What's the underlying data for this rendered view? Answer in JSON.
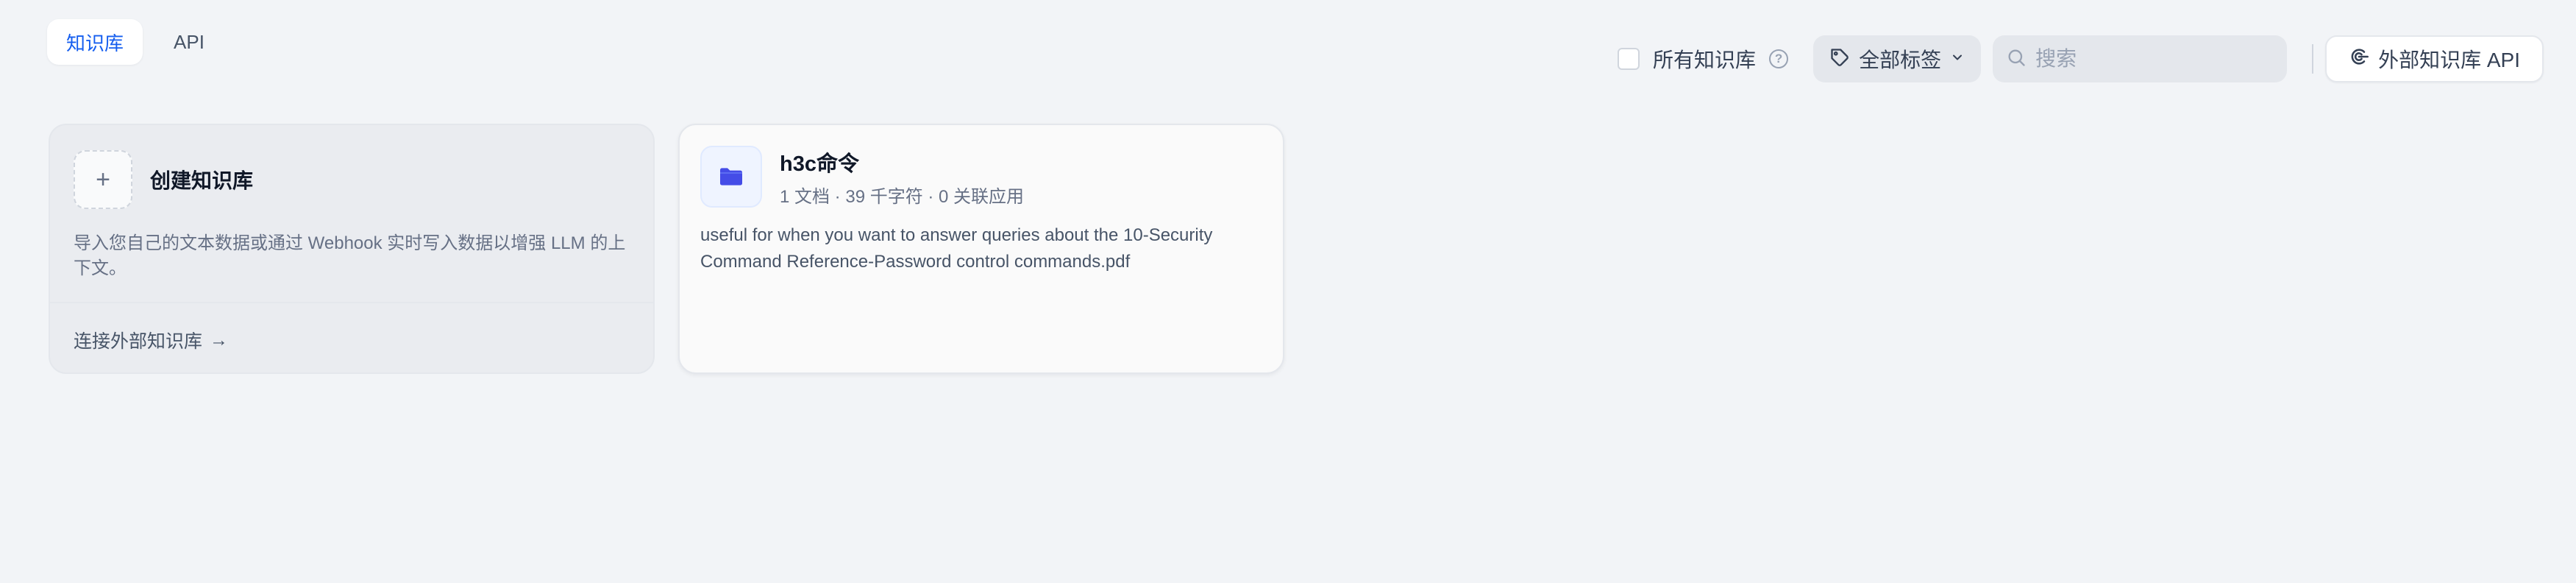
{
  "tabs": [
    {
      "label": "知识库",
      "active": true
    },
    {
      "label": "API",
      "active": false
    }
  ],
  "toolbar": {
    "all_kb_label": "所有知识库",
    "help_glyph": "?",
    "tag_filter_label": "全部标签",
    "search_placeholder": "搜索",
    "external_api_label": "外部知识库 API"
  },
  "create_card": {
    "plus": "+",
    "title": "创建知识库",
    "description": "导入您自己的文本数据或通过 Webhook 实时写入数据以增强 LLM 的上下文。",
    "connect_link": "连接外部知识库",
    "connect_arrow": "→"
  },
  "knowledge_bases": [
    {
      "name": "h3c命令",
      "meta": "1 文档 · 39 千字符 · 0 关联应用",
      "description": "useful for when you want to answer queries about the 10-Security Command Reference-Password control commands.pdf"
    }
  ],
  "colors": {
    "accent": "#155eef",
    "background": "#f2f4f7",
    "folder_icon": "#444ce7"
  },
  "icons": {
    "help": "help-circle-icon",
    "tag": "tag-icon",
    "chevron": "chevron-down-icon",
    "search": "search-icon",
    "api": "api-connection-icon",
    "folder": "folder-icon",
    "plus": "plus-icon",
    "arrow": "arrow-right-icon"
  }
}
